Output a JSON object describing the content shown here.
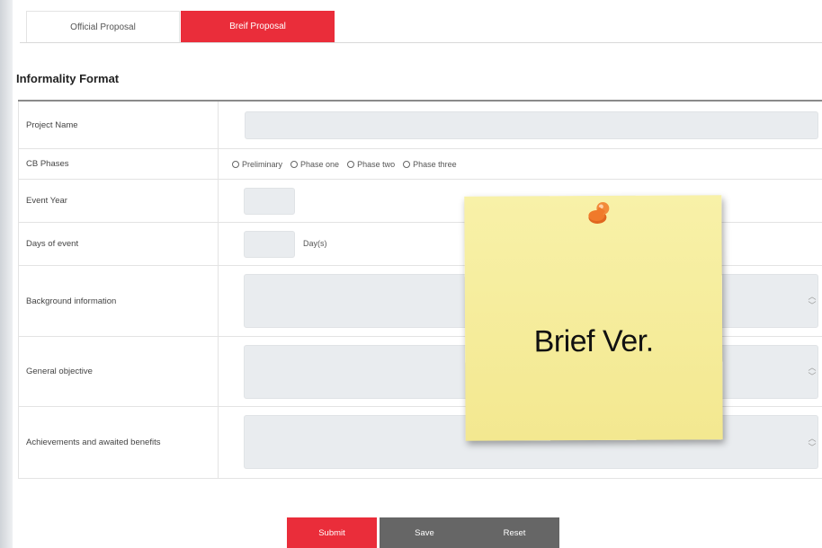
{
  "tabs": {
    "official": "Official Proposal",
    "brief": "Breif Proposal"
  },
  "section_title": "Informality Format",
  "form": {
    "project_name_label": "Project Name",
    "cb_phases_label": "CB Phases",
    "phase_options": [
      "Preliminary",
      "Phase one",
      "Phase two",
      "Phase three"
    ],
    "event_year_label": "Event Year",
    "days_label": "Days of event",
    "days_unit": "Day(s)",
    "background_label": "Background information",
    "objective_label": "General objective",
    "achievements_label": "Achievements and awaited benefits"
  },
  "buttons": {
    "submit": "Submit",
    "save": "Save",
    "reset": "Reset"
  },
  "sticky_note": {
    "text": "Brief Ver."
  },
  "colors": {
    "accent": "#ea2d3a",
    "button_gray": "#666666",
    "note_yellow": "#f6ee9e",
    "pin_orange": "#f07a2a"
  }
}
